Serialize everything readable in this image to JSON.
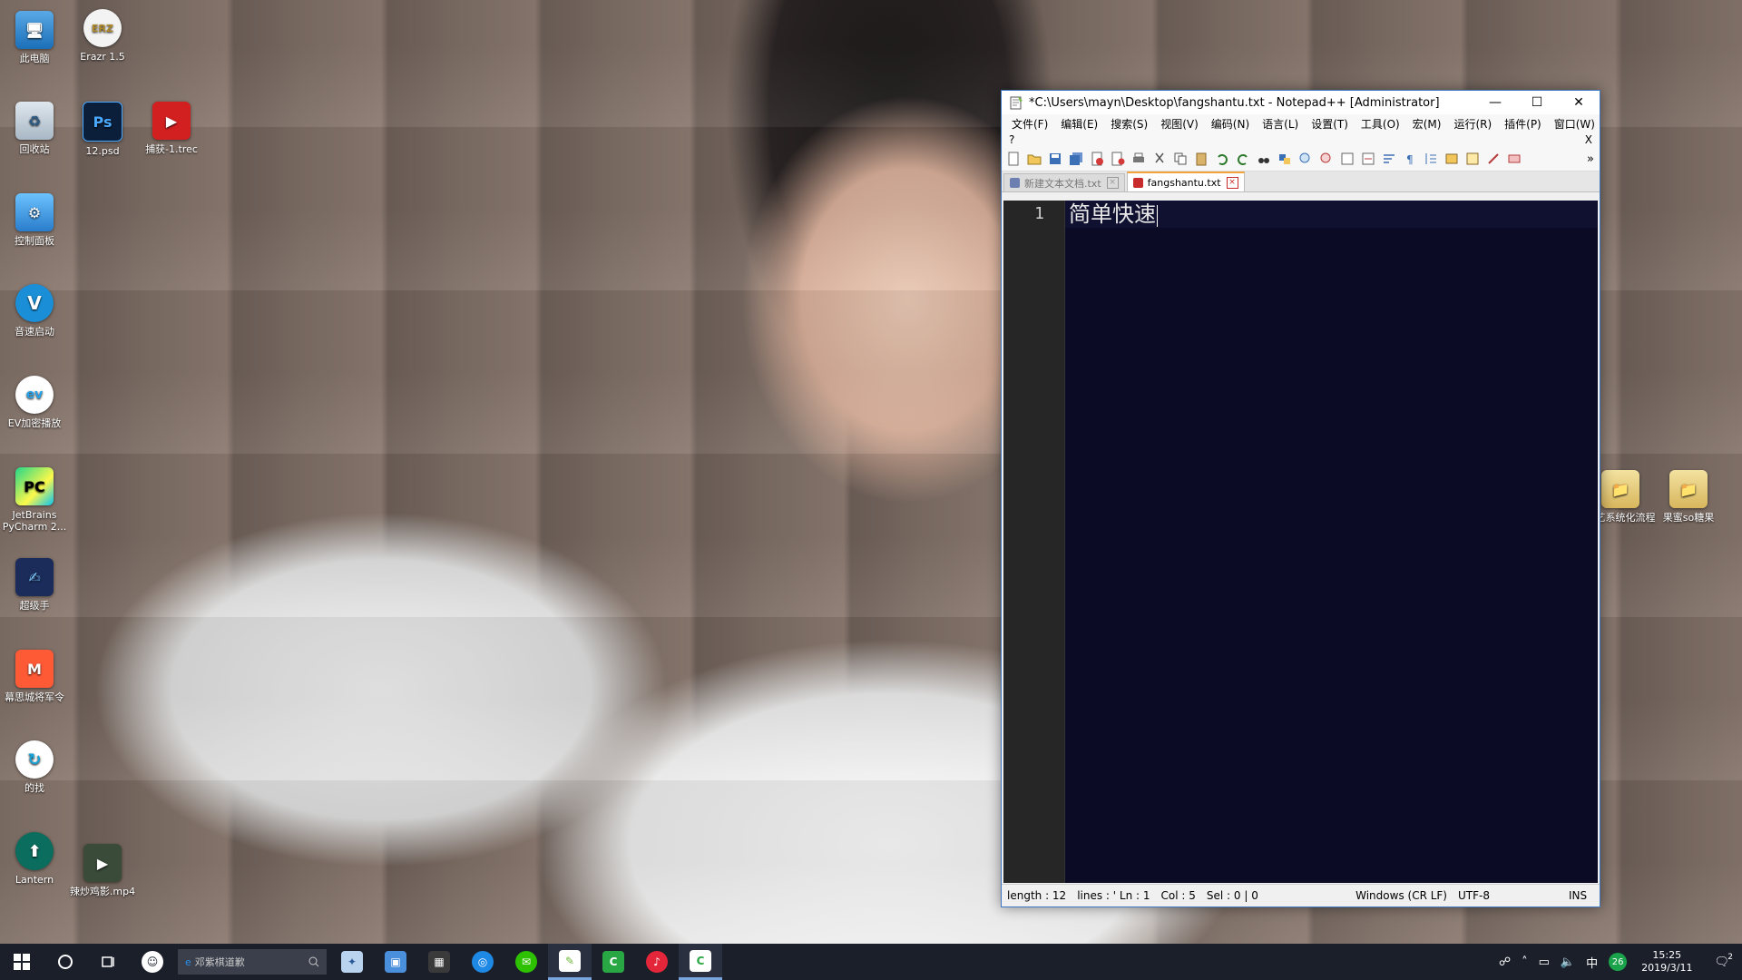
{
  "desktop": {
    "icons": [
      {
        "label": "此电脑",
        "glyph": "🖥"
      },
      {
        "label": "Erazr 1.5",
        "glyph": "ERZ"
      },
      {
        "label": "回收站",
        "glyph": "♻"
      },
      {
        "label": "12.psd",
        "glyph": "Ps"
      },
      {
        "label": "捕获-1.trec",
        "glyph": "▶"
      },
      {
        "label": "控制面板",
        "glyph": "⚙"
      },
      {
        "label": "音速启动",
        "glyph": "V"
      },
      {
        "label": "EV加密播放",
        "glyph": "ev"
      },
      {
        "label": "JetBrains PyCharm 2...",
        "glyph": "PC"
      },
      {
        "label": "超级手",
        "glyph": "✍"
      },
      {
        "label": "幕思城将军令",
        "glyph": "M"
      },
      {
        "label": "的找",
        "glyph": "↻"
      },
      {
        "label": "Lantern",
        "glyph": "⬆"
      },
      {
        "label": "辣炒鸡影.mp4",
        "glyph": "▶"
      },
      {
        "label": "奇艺系统化流程",
        "glyph": "📁"
      },
      {
        "label": "果蜜so糖果",
        "glyph": "📁"
      }
    ]
  },
  "window": {
    "title": "*C:\\Users\\mayn\\Desktop\\fangshantu.txt - Notepad++ [Administrator]",
    "controls": {
      "minimize": "—",
      "maximize": "☐",
      "close": "✕"
    },
    "menu": [
      "文件(F)",
      "编辑(E)",
      "搜索(S)",
      "视图(V)",
      "编码(N)",
      "语言(L)",
      "设置(T)",
      "工具(O)",
      "宏(M)",
      "运行(R)",
      "插件(P)",
      "窗口(W)"
    ],
    "menu_row2": {
      "help": "?",
      "close": "X"
    },
    "toolbar_overflow": "»",
    "tabs": [
      {
        "label": "新建文本文档.txt",
        "active": false
      },
      {
        "label": "fangshantu.txt",
        "active": true
      }
    ],
    "editor": {
      "line_numbers": [
        "1"
      ],
      "lines": [
        "简单快速"
      ]
    },
    "status": {
      "length": "length : 12",
      "lines": "lines : ' Ln : 1",
      "col": "Col : 5",
      "sel": "Sel : 0 | 0",
      "eol": "Windows (CR LF)",
      "encoding": "UTF-8",
      "mode": "INS"
    }
  },
  "taskbar": {
    "search_placeholder": "邓紫棋道歉",
    "clock_time": "15:25",
    "clock_date": "2019/3/11",
    "ime": "中",
    "badge": "26",
    "notification_count": "2"
  }
}
